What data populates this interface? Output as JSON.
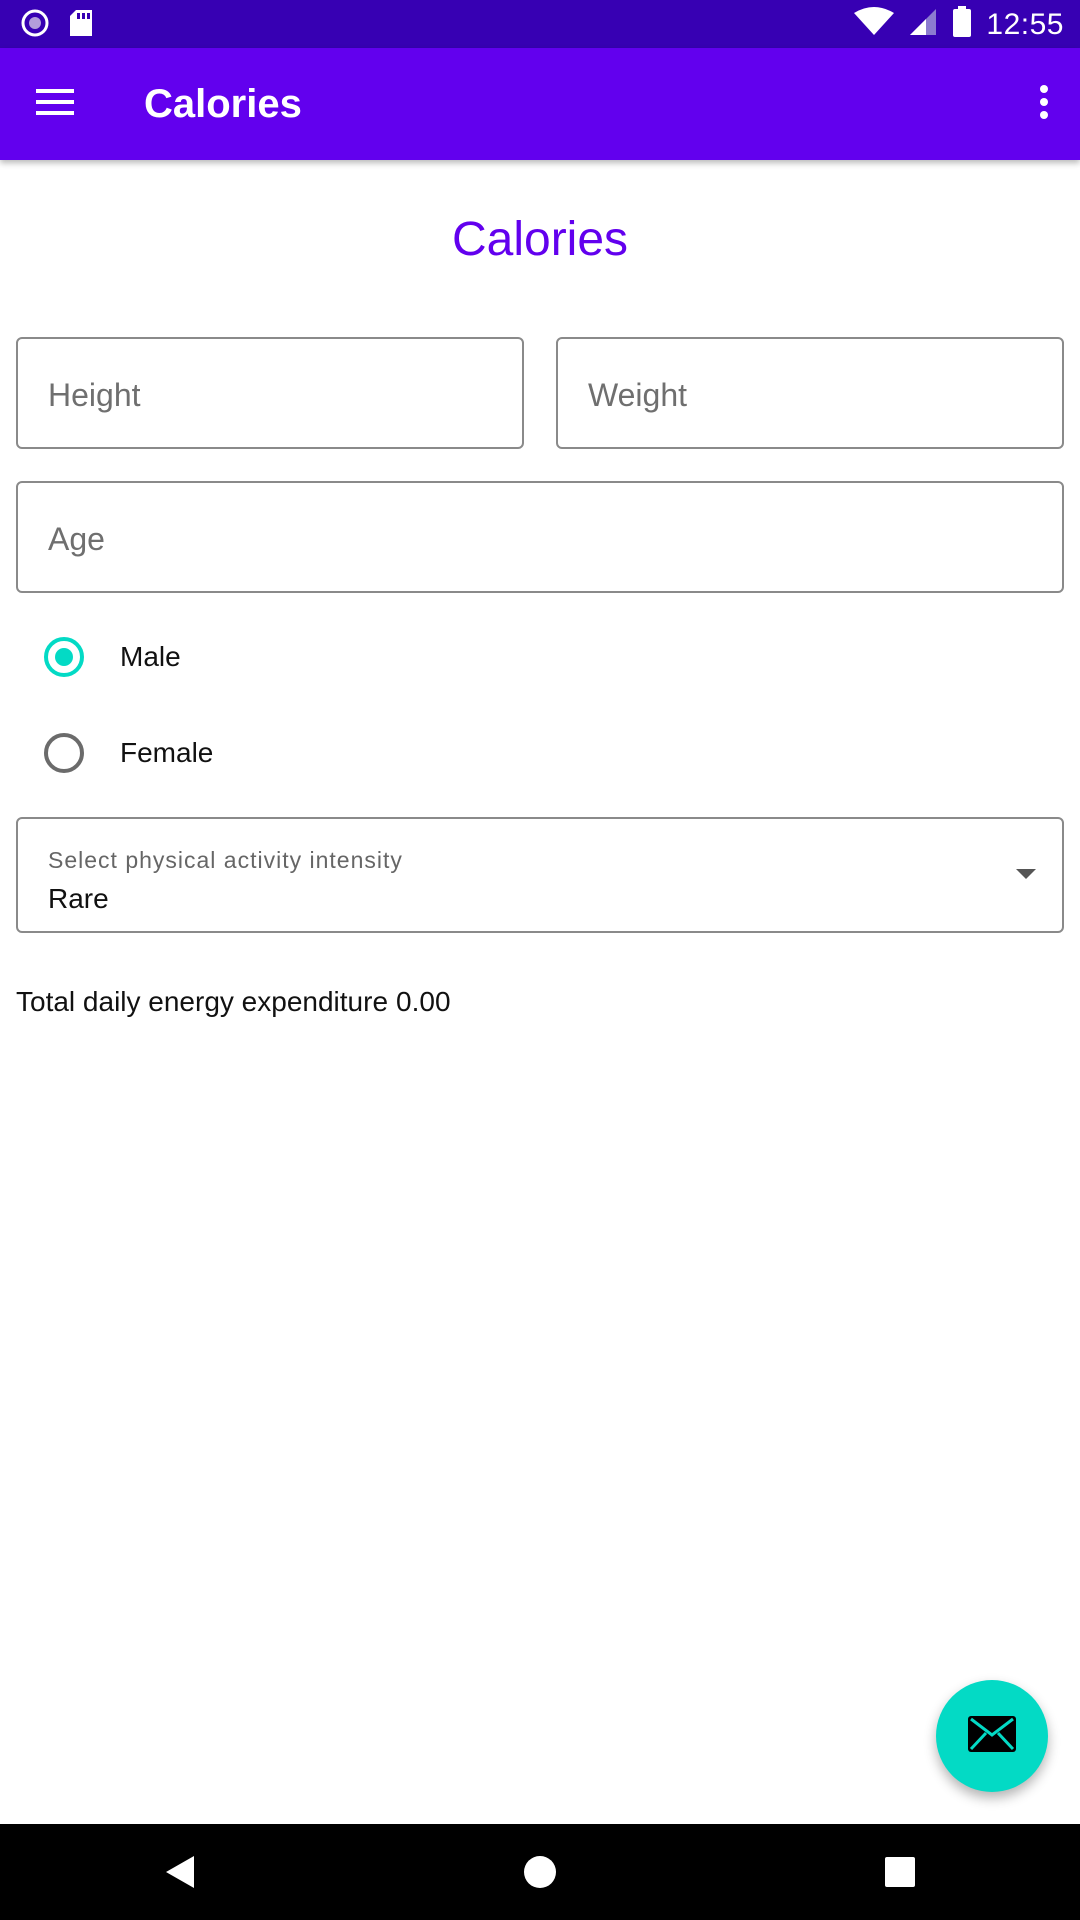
{
  "status_bar": {
    "time": "12:55",
    "icons": [
      "record-icon",
      "sd-card-icon",
      "wifi-icon",
      "signal-icon",
      "battery-icon"
    ]
  },
  "app_bar": {
    "title": "Calories",
    "menu_icon": "hamburger-menu-icon",
    "overflow_icon": "more-vert-icon"
  },
  "form": {
    "heading": "Calories",
    "height_placeholder": "Height",
    "weight_placeholder": "Weight",
    "age_placeholder": "Age",
    "sex_options": [
      {
        "label": "Male",
        "checked": true
      },
      {
        "label": "Female",
        "checked": false
      }
    ],
    "activity": {
      "label": "Select physical activity intensity",
      "selected": "Rare"
    },
    "tdee_label": "Total daily energy expenditure",
    "tdee_value": "0.00"
  },
  "fab": {
    "icon": "email-icon"
  },
  "colors": {
    "status_bar": "#3700b3",
    "primary": "#6200ee",
    "accent": "#03dac5"
  },
  "nav_bar": {
    "icons": [
      "back-icon",
      "home-icon",
      "recents-icon"
    ]
  }
}
